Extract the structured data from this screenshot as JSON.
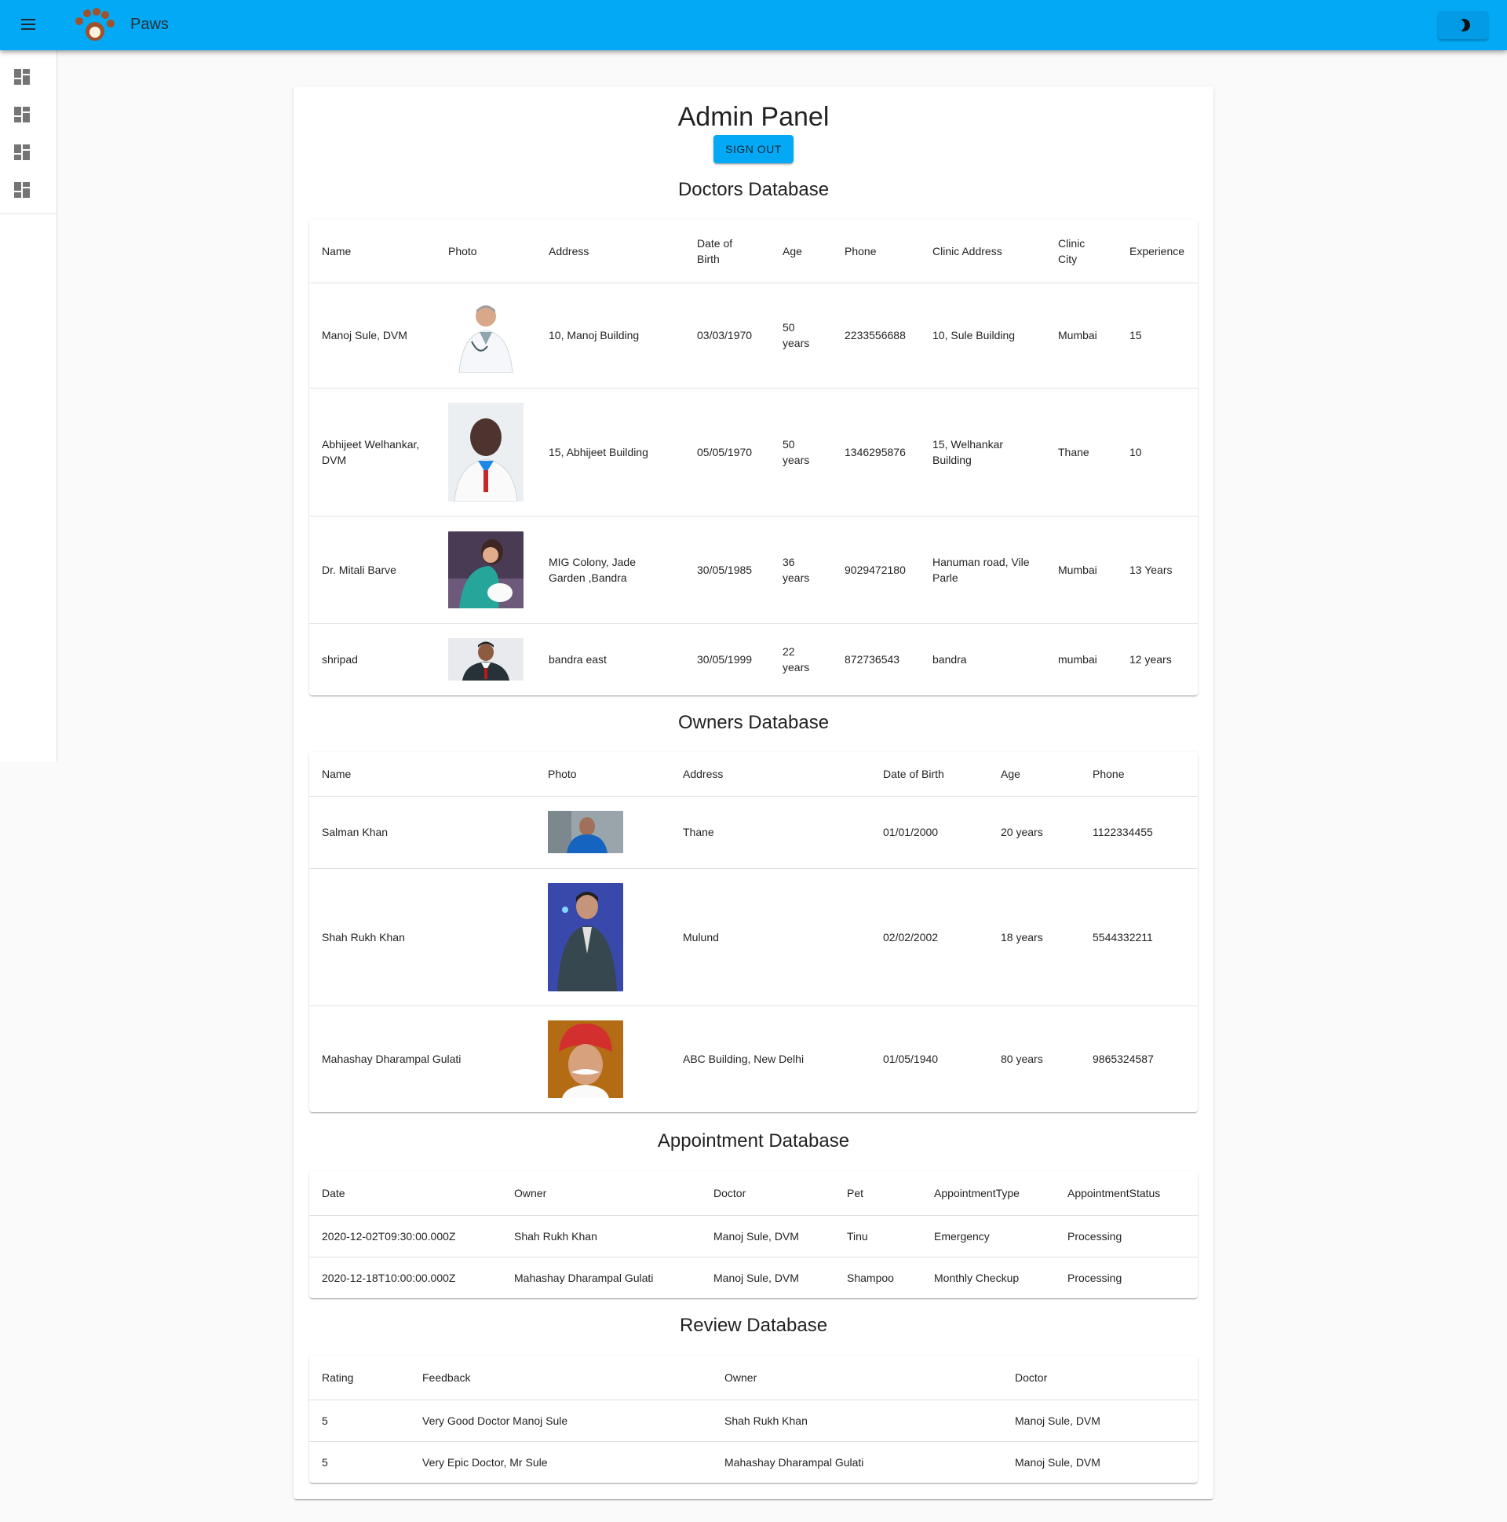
{
  "app": {
    "title": "Paws",
    "accent": "#03a9f4"
  },
  "drawer": {
    "icons": [
      "dashboard-icon",
      "dashboard-icon",
      "dashboard-icon",
      "dashboard-icon"
    ]
  },
  "panel": {
    "title": "Admin Panel",
    "signout_label": "SIGN OUT"
  },
  "doctors": {
    "title": "Doctors Database",
    "headers": [
      "Name",
      "Photo",
      "Address",
      "Date of Birth",
      "Age",
      "Phone",
      "Clinic Address",
      "Clinic City",
      "Experience"
    ],
    "rows": [
      {
        "name": "Manoj Sule, DVM",
        "address": "10, Manoj Building",
        "dob": "03/03/1970",
        "age": "50 years",
        "phone": "2233556688",
        "clinic_address": "10, Sule Building",
        "clinic_city": "Mumbai",
        "experience": "15"
      },
      {
        "name": "Abhijeet Welhankar, DVM",
        "address": "15, Abhijeet Building",
        "dob": "05/05/1970",
        "age": "50 years",
        "phone": "1346295876",
        "clinic_address": "15, Welhankar Building",
        "clinic_city": "Thane",
        "experience": "10"
      },
      {
        "name": "Dr. Mitali Barve",
        "address": "MIG Colony, Jade Garden ,Bandra",
        "dob": "30/05/1985",
        "age": "36 years",
        "phone": "9029472180",
        "clinic_address": "Hanuman road, Vile Parle",
        "clinic_city": "Mumbai",
        "experience": "13 Years"
      },
      {
        "name": "shripad",
        "address": "bandra east",
        "dob": "30/05/1999",
        "age": "22 years",
        "phone": "872736543",
        "clinic_address": "bandra",
        "clinic_city": "mumbai",
        "experience": "12 years"
      }
    ]
  },
  "owners": {
    "title": "Owners Database",
    "headers": [
      "Name",
      "Photo",
      "Address",
      "Date of Birth",
      "Age",
      "Phone"
    ],
    "rows": [
      {
        "name": "Salman Khan",
        "address": "Thane",
        "dob": "01/01/2000",
        "age": "20 years",
        "phone": "1122334455"
      },
      {
        "name": "Shah Rukh Khan",
        "address": "Mulund",
        "dob": "02/02/2002",
        "age": "18 years",
        "phone": "5544332211"
      },
      {
        "name": "Mahashay Dharampal Gulati",
        "address": "ABC Building, New Delhi",
        "dob": "01/05/1940",
        "age": "80 years",
        "phone": "9865324587"
      }
    ]
  },
  "appointments": {
    "title": "Appointment Database",
    "headers": [
      "Date",
      "Owner",
      "Doctor",
      "Pet",
      "AppointmentType",
      "AppointmentStatus"
    ],
    "rows": [
      {
        "date": "2020-12-02T09:30:00.000Z",
        "owner": "Shah Rukh Khan",
        "doctor": "Manoj Sule, DVM",
        "pet": "Tinu",
        "type": "Emergency",
        "status": "Processing"
      },
      {
        "date": "2020-12-18T10:00:00.000Z",
        "owner": "Mahashay Dharampal Gulati",
        "doctor": "Manoj Sule, DVM",
        "pet": "Shampoo",
        "type": "Monthly Checkup",
        "status": "Processing"
      }
    ]
  },
  "reviews": {
    "title": "Review Database",
    "headers": [
      "Rating",
      "Feedback",
      "Owner",
      "Doctor"
    ],
    "rows": [
      {
        "rating": "5",
        "feedback": "Very Good Doctor Manoj Sule",
        "owner": "Shah Rukh Khan",
        "doctor": "Manoj Sule, DVM"
      },
      {
        "rating": "5",
        "feedback": "Very Epic Doctor, Mr Sule",
        "owner": "Mahashay Dharampal Gulati",
        "doctor": "Manoj Sule, DVM"
      }
    ]
  }
}
